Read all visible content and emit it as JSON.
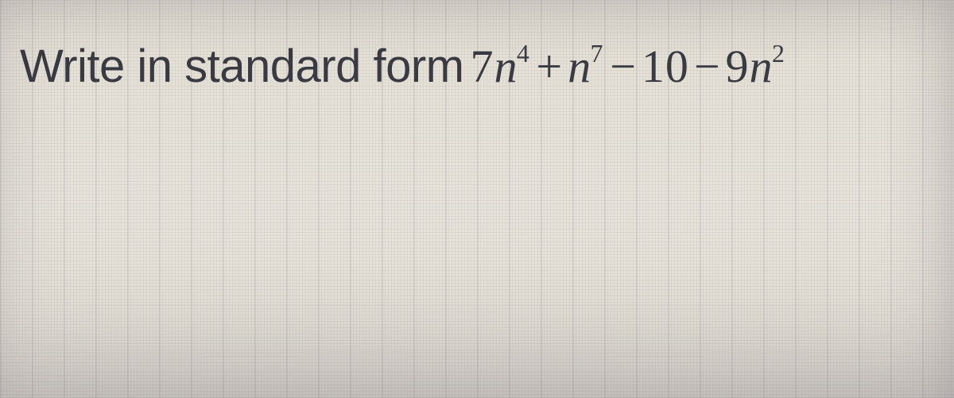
{
  "question": {
    "prompt": "Write in standard form",
    "expression": {
      "t1_coef": "7",
      "t1_var": "n",
      "t1_exp": "4",
      "op1": "+",
      "t2_var": "n",
      "t2_exp": "7",
      "op2": "−",
      "t3_const": "10",
      "op3": "−",
      "t4_coef": "9",
      "t4_var": "n",
      "t4_exp": "2"
    }
  }
}
